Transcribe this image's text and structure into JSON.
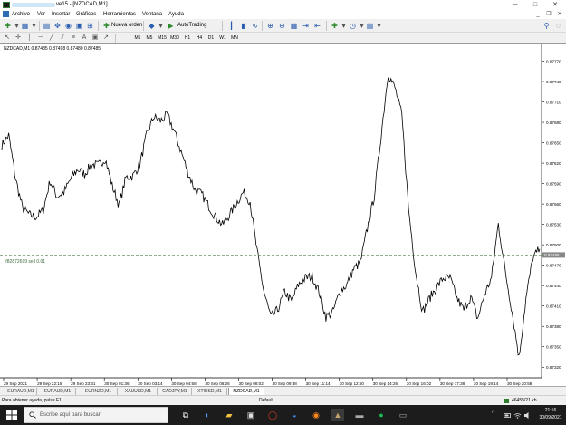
{
  "window": {
    "title_visible": "ve15 - [NZDCAD,M1]",
    "min_glyph": "─",
    "max_glyph": "□",
    "close_glyph": "✕"
  },
  "menu": {
    "items": [
      "Archivo",
      "Ver",
      "Insertar",
      "Gráficos",
      "Herramientas",
      "Ventana",
      "Ayuda"
    ],
    "mdi_min": "_",
    "mdi_restore": "❐",
    "mdi_close": "✕"
  },
  "toolbar": {
    "new_order_label": "Nueva orden",
    "autotrading_label": "AutoTrading",
    "timeframes": [
      "M1",
      "M5",
      "M15",
      "M30",
      "H1",
      "H4",
      "D1",
      "W1",
      "MN"
    ]
  },
  "chart": {
    "header": "NZDCAD,M1  0.87485 0.87498 0.87480 0.87485",
    "order_label": "#82872699 sell 0.01",
    "current_price": "0.87485",
    "colors": {
      "price_line": "#000000",
      "order_line": "#4f7f4f",
      "current_price_bg": "#888888"
    }
  },
  "chart_data": {
    "type": "line",
    "title": "NZDCAD,M1",
    "y_ticks": [
      "0.87770",
      "0.87740",
      "0.87710",
      "0.87680",
      "0.87650",
      "0.87620",
      "0.87590",
      "0.87560",
      "0.87530",
      "0.87500",
      "0.87470",
      "0.87440",
      "0.87410",
      "0.87380",
      "0.87350",
      "0.87320"
    ],
    "x_ticks": [
      "29 Sep 2021",
      "29 Sep 22:15",
      "29 Sep 23:31",
      "30 Sep 01:36",
      "30 Sep 03:14",
      "30 Sep 04:58",
      "30 Sep 06:26",
      "30 Sep 08:02",
      "30 Sep 09:38",
      "30 Sep 11:14",
      "30 Sep 12:50",
      "30 Sep 14:26",
      "30 Sep 16:02",
      "30 Sep 17:38",
      "30 Sep 19:14",
      "30 Sep 20:58"
    ],
    "ylim": [
      0.87307,
      0.87792
    ],
    "grid": false,
    "series": [
      {
        "values": [
          0.87647,
          0.87661,
          0.87597,
          0.87554,
          0.87544,
          0.87541,
          0.87551,
          0.87594,
          0.87571,
          0.87577,
          0.87597,
          0.87611,
          0.87604,
          0.87618,
          0.87617,
          0.87627,
          0.87587,
          0.87558,
          0.87599,
          0.87601,
          0.87618,
          0.87661,
          0.87688,
          0.87682,
          0.87691,
          0.87667,
          0.87637,
          0.87606,
          0.87581,
          0.87574,
          0.87557,
          0.87541,
          0.87529,
          0.87544,
          0.87561,
          0.87577,
          0.87564,
          0.87491,
          0.87431,
          0.87394,
          0.87404,
          0.87431,
          0.87417,
          0.87441,
          0.87451,
          0.87454,
          0.87431,
          0.87394,
          0.87401,
          0.87431,
          0.87441,
          0.87464,
          0.87474,
          0.87524,
          0.87571,
          0.87661,
          0.87751,
          0.87731,
          0.87691,
          0.87551,
          0.87461,
          0.87401,
          0.87421,
          0.87437,
          0.87451,
          0.87451,
          0.87421,
          0.87404,
          0.87424,
          0.87391,
          0.87427,
          0.87451,
          0.87531,
          0.87461,
          0.87401,
          0.87334,
          0.87421,
          0.87481,
          0.87494
        ]
      }
    ]
  },
  "tabs": [
    "EURAUD,M1",
    "EURAUD,M1",
    "EURNZD,M1",
    "XAUUSD,M1",
    "CADJPY,M1",
    "XTIUSD,M1",
    "NZDCAD,M1"
  ],
  "active_tab": "NZDCAD,M1",
  "status": {
    "help": "Para obtener ayuda, pulse F1",
    "profile": "Default",
    "traffic": "46455/21 kb"
  },
  "taskbar": {
    "search_placeholder": "Escribe aquí para buscar",
    "time": "21:16",
    "date": "30/09/2021"
  }
}
